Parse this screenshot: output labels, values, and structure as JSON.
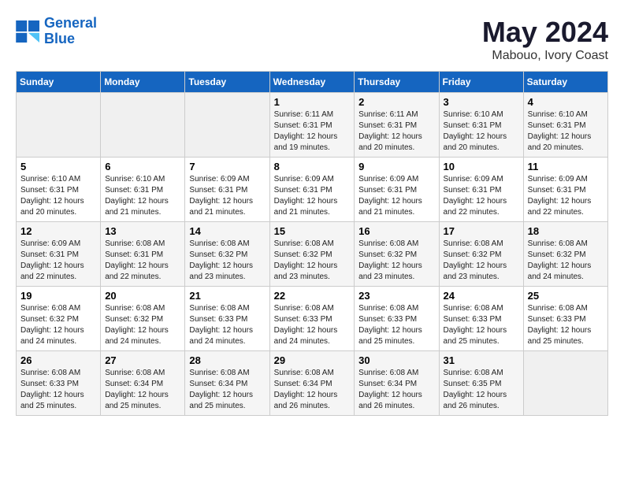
{
  "logo": {
    "line1": "General",
    "line2": "Blue"
  },
  "title": "May 2024",
  "location": "Mabouo, Ivory Coast",
  "weekdays": [
    "Sunday",
    "Monday",
    "Tuesday",
    "Wednesday",
    "Thursday",
    "Friday",
    "Saturday"
  ],
  "weeks": [
    [
      {
        "day": "",
        "sunrise": "",
        "sunset": "",
        "daylight": ""
      },
      {
        "day": "",
        "sunrise": "",
        "sunset": "",
        "daylight": ""
      },
      {
        "day": "",
        "sunrise": "",
        "sunset": "",
        "daylight": ""
      },
      {
        "day": "1",
        "sunrise": "Sunrise: 6:11 AM",
        "sunset": "Sunset: 6:31 PM",
        "daylight": "Daylight: 12 hours and 19 minutes."
      },
      {
        "day": "2",
        "sunrise": "Sunrise: 6:11 AM",
        "sunset": "Sunset: 6:31 PM",
        "daylight": "Daylight: 12 hours and 20 minutes."
      },
      {
        "day": "3",
        "sunrise": "Sunrise: 6:10 AM",
        "sunset": "Sunset: 6:31 PM",
        "daylight": "Daylight: 12 hours and 20 minutes."
      },
      {
        "day": "4",
        "sunrise": "Sunrise: 6:10 AM",
        "sunset": "Sunset: 6:31 PM",
        "daylight": "Daylight: 12 hours and 20 minutes."
      }
    ],
    [
      {
        "day": "5",
        "sunrise": "Sunrise: 6:10 AM",
        "sunset": "Sunset: 6:31 PM",
        "daylight": "Daylight: 12 hours and 20 minutes."
      },
      {
        "day": "6",
        "sunrise": "Sunrise: 6:10 AM",
        "sunset": "Sunset: 6:31 PM",
        "daylight": "Daylight: 12 hours and 21 minutes."
      },
      {
        "day": "7",
        "sunrise": "Sunrise: 6:09 AM",
        "sunset": "Sunset: 6:31 PM",
        "daylight": "Daylight: 12 hours and 21 minutes."
      },
      {
        "day": "8",
        "sunrise": "Sunrise: 6:09 AM",
        "sunset": "Sunset: 6:31 PM",
        "daylight": "Daylight: 12 hours and 21 minutes."
      },
      {
        "day": "9",
        "sunrise": "Sunrise: 6:09 AM",
        "sunset": "Sunset: 6:31 PM",
        "daylight": "Daylight: 12 hours and 21 minutes."
      },
      {
        "day": "10",
        "sunrise": "Sunrise: 6:09 AM",
        "sunset": "Sunset: 6:31 PM",
        "daylight": "Daylight: 12 hours and 22 minutes."
      },
      {
        "day": "11",
        "sunrise": "Sunrise: 6:09 AM",
        "sunset": "Sunset: 6:31 PM",
        "daylight": "Daylight: 12 hours and 22 minutes."
      }
    ],
    [
      {
        "day": "12",
        "sunrise": "Sunrise: 6:09 AM",
        "sunset": "Sunset: 6:31 PM",
        "daylight": "Daylight: 12 hours and 22 minutes."
      },
      {
        "day": "13",
        "sunrise": "Sunrise: 6:08 AM",
        "sunset": "Sunset: 6:31 PM",
        "daylight": "Daylight: 12 hours and 22 minutes."
      },
      {
        "day": "14",
        "sunrise": "Sunrise: 6:08 AM",
        "sunset": "Sunset: 6:32 PM",
        "daylight": "Daylight: 12 hours and 23 minutes."
      },
      {
        "day": "15",
        "sunrise": "Sunrise: 6:08 AM",
        "sunset": "Sunset: 6:32 PM",
        "daylight": "Daylight: 12 hours and 23 minutes."
      },
      {
        "day": "16",
        "sunrise": "Sunrise: 6:08 AM",
        "sunset": "Sunset: 6:32 PM",
        "daylight": "Daylight: 12 hours and 23 minutes."
      },
      {
        "day": "17",
        "sunrise": "Sunrise: 6:08 AM",
        "sunset": "Sunset: 6:32 PM",
        "daylight": "Daylight: 12 hours and 23 minutes."
      },
      {
        "day": "18",
        "sunrise": "Sunrise: 6:08 AM",
        "sunset": "Sunset: 6:32 PM",
        "daylight": "Daylight: 12 hours and 24 minutes."
      }
    ],
    [
      {
        "day": "19",
        "sunrise": "Sunrise: 6:08 AM",
        "sunset": "Sunset: 6:32 PM",
        "daylight": "Daylight: 12 hours and 24 minutes."
      },
      {
        "day": "20",
        "sunrise": "Sunrise: 6:08 AM",
        "sunset": "Sunset: 6:32 PM",
        "daylight": "Daylight: 12 hours and 24 minutes."
      },
      {
        "day": "21",
        "sunrise": "Sunrise: 6:08 AM",
        "sunset": "Sunset: 6:33 PM",
        "daylight": "Daylight: 12 hours and 24 minutes."
      },
      {
        "day": "22",
        "sunrise": "Sunrise: 6:08 AM",
        "sunset": "Sunset: 6:33 PM",
        "daylight": "Daylight: 12 hours and 24 minutes."
      },
      {
        "day": "23",
        "sunrise": "Sunrise: 6:08 AM",
        "sunset": "Sunset: 6:33 PM",
        "daylight": "Daylight: 12 hours and 25 minutes."
      },
      {
        "day": "24",
        "sunrise": "Sunrise: 6:08 AM",
        "sunset": "Sunset: 6:33 PM",
        "daylight": "Daylight: 12 hours and 25 minutes."
      },
      {
        "day": "25",
        "sunrise": "Sunrise: 6:08 AM",
        "sunset": "Sunset: 6:33 PM",
        "daylight": "Daylight: 12 hours and 25 minutes."
      }
    ],
    [
      {
        "day": "26",
        "sunrise": "Sunrise: 6:08 AM",
        "sunset": "Sunset: 6:33 PM",
        "daylight": "Daylight: 12 hours and 25 minutes."
      },
      {
        "day": "27",
        "sunrise": "Sunrise: 6:08 AM",
        "sunset": "Sunset: 6:34 PM",
        "daylight": "Daylight: 12 hours and 25 minutes."
      },
      {
        "day": "28",
        "sunrise": "Sunrise: 6:08 AM",
        "sunset": "Sunset: 6:34 PM",
        "daylight": "Daylight: 12 hours and 25 minutes."
      },
      {
        "day": "29",
        "sunrise": "Sunrise: 6:08 AM",
        "sunset": "Sunset: 6:34 PM",
        "daylight": "Daylight: 12 hours and 26 minutes."
      },
      {
        "day": "30",
        "sunrise": "Sunrise: 6:08 AM",
        "sunset": "Sunset: 6:34 PM",
        "daylight": "Daylight: 12 hours and 26 minutes."
      },
      {
        "day": "31",
        "sunrise": "Sunrise: 6:08 AM",
        "sunset": "Sunset: 6:35 PM",
        "daylight": "Daylight: 12 hours and 26 minutes."
      },
      {
        "day": "",
        "sunrise": "",
        "sunset": "",
        "daylight": ""
      }
    ]
  ]
}
